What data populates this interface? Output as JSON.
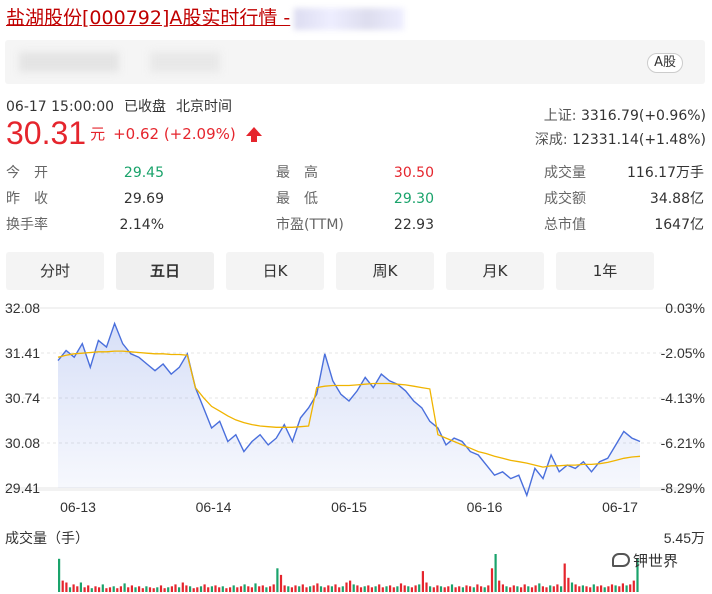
{
  "title": {
    "stock_name": "盐湖股份",
    "code_and_suffix": "[000792]A股实时行情 -"
  },
  "badge": "A股",
  "status": {
    "datetime": "06-17 15:00:00",
    "state": "已收盘",
    "timezone": "北京时间"
  },
  "price": {
    "last": "30.31",
    "unit": "元",
    "change": "+0.62 (+2.09%)"
  },
  "indices": [
    {
      "name": "上证:",
      "value": "3316.79(+0.96%)"
    },
    {
      "name": "深成:",
      "value": "12331.14(+1.48%)"
    }
  ],
  "stats": {
    "open_label": "今　开",
    "open": "29.45",
    "prev_label": "昨　收",
    "prev": "29.69",
    "turnover_label": "换手率",
    "turnover": "2.14%",
    "high_label": "最　高",
    "high": "30.50",
    "low_label": "最　低",
    "low": "29.30",
    "pe_label": "市盈(TTM)",
    "pe": "22.93",
    "volume_label": "成交量",
    "volume": "116.17万手",
    "amount_label": "成交额",
    "amount": "34.88亿",
    "mcap_label": "总市值",
    "mcap": "1647亿"
  },
  "tabs": [
    "分时",
    "五日",
    "日K",
    "周K",
    "月K",
    "1年"
  ],
  "active_tab": "五日",
  "chart_data": {
    "type": "line",
    "x_ticks": [
      "06-13",
      "06-14",
      "06-15",
      "06-16",
      "06-17"
    ],
    "y_ticks_left": [
      "32.08",
      "31.41",
      "30.74",
      "30.08",
      "29.41"
    ],
    "y_ticks_right": [
      "0.03%",
      "-2.05%",
      "-4.13%",
      "-6.21%",
      "-8.29%"
    ],
    "ylim": [
      29.41,
      32.08
    ],
    "series": [
      {
        "color": "#4a6fdc",
        "values": [
          31.3,
          31.45,
          31.35,
          31.55,
          31.2,
          31.6,
          31.5,
          31.85,
          31.55,
          31.4,
          31.35,
          31.25,
          31.15,
          31.25,
          31.1,
          31.2,
          31.4,
          30.9,
          30.6,
          30.3,
          30.4,
          30.1,
          30.2,
          29.95,
          30.1,
          30.2,
          30.05,
          30.15,
          30.35,
          30.1,
          30.45,
          30.6,
          30.8,
          31.4,
          31.0,
          30.8,
          30.7,
          30.85,
          31.05,
          30.9,
          31.1,
          31.0,
          30.95,
          30.85,
          30.7,
          30.6,
          30.4,
          30.3,
          30.05,
          30.15,
          30.1,
          29.95,
          29.9,
          29.75,
          29.6,
          29.65,
          29.55,
          29.6,
          29.3,
          29.7,
          29.55,
          29.9,
          29.65,
          29.75,
          29.7,
          29.8,
          29.65,
          29.8,
          29.85,
          30.05,
          30.25,
          30.15,
          30.1
        ]
      },
      {
        "color": "#f0b400",
        "values": [
          31.35,
          31.38,
          31.4,
          31.41,
          31.42,
          31.43,
          31.43,
          31.44,
          31.44,
          31.43,
          31.42,
          31.41,
          31.4,
          31.4,
          31.39,
          31.39,
          31.38,
          30.9,
          30.75,
          30.62,
          30.55,
          30.48,
          30.42,
          30.38,
          30.35,
          30.33,
          30.32,
          30.31,
          30.31,
          30.31,
          30.32,
          30.33,
          30.9,
          30.92,
          30.93,
          30.93,
          30.93,
          30.94,
          30.95,
          30.96,
          30.96,
          30.96,
          30.95,
          30.94,
          30.92,
          30.9,
          30.88,
          30.2,
          30.15,
          30.1,
          30.05,
          30.0,
          29.95,
          29.92,
          29.88,
          29.85,
          29.82,
          29.8,
          29.78,
          29.75,
          29.72,
          29.74,
          29.74,
          29.75,
          29.75,
          29.76,
          29.76,
          29.77,
          29.79,
          29.82,
          29.85,
          29.87,
          29.88
        ]
      }
    ],
    "volume_label": "成交量（手）",
    "volume_max_label": "5.45万",
    "volume_bars": [
      0.35,
      0.12,
      0.1,
      0.05,
      0.08,
      0.06,
      0.1,
      0.05,
      0.07,
      0.04,
      0.06,
      0.05,
      0.08,
      0.04,
      0.05,
      0.06,
      0.04,
      0.06,
      0.09,
      0.05,
      0.07,
      0.05,
      0.06,
      0.04,
      0.06,
      0.05,
      0.04,
      0.05,
      0.07,
      0.04,
      0.05,
      0.06,
      0.08,
      0.05,
      0.1,
      0.07,
      0.06,
      0.04,
      0.05,
      0.06,
      0.08,
      0.05,
      0.06,
      0.07,
      0.05,
      0.06,
      0.04,
      0.05,
      0.07,
      0.05,
      0.06,
      0.08,
      0.06,
      0.05,
      0.09,
      0.06,
      0.07,
      0.05,
      0.06,
      0.08,
      0.25,
      0.18,
      0.07,
      0.06,
      0.05,
      0.07,
      0.06,
      0.08,
      0.05,
      0.06,
      0.07,
      0.09,
      0.06,
      0.05,
      0.07,
      0.06,
      0.08,
      0.05,
      0.06,
      0.1,
      0.12,
      0.08,
      0.07,
      0.05,
      0.06,
      0.07,
      0.05,
      0.06,
      0.08,
      0.05,
      0.06,
      0.07,
      0.05,
      0.06,
      0.09,
      0.07,
      0.06,
      0.05,
      0.07,
      0.08,
      0.22,
      0.1,
      0.06,
      0.05,
      0.07,
      0.06,
      0.05,
      0.06,
      0.08,
      0.05,
      0.06,
      0.05,
      0.07,
      0.06,
      0.05,
      0.08,
      0.06,
      0.05,
      0.07,
      0.25,
      0.4,
      0.12,
      0.08,
      0.06,
      0.05,
      0.07,
      0.06,
      0.05,
      0.08,
      0.06,
      0.05,
      0.07,
      0.09,
      0.06,
      0.05,
      0.07,
      0.06,
      0.08,
      0.06,
      0.3,
      0.15,
      0.1,
      0.08,
      0.06,
      0.07,
      0.06,
      0.05,
      0.08,
      0.06,
      0.07,
      0.05,
      0.06,
      0.08,
      0.07,
      0.06,
      0.09,
      0.07,
      0.08,
      0.12,
      0.35
    ],
    "volume_colors": [
      "#e5252d",
      "#1aa36b"
    ]
  },
  "watermark": "钾世界"
}
